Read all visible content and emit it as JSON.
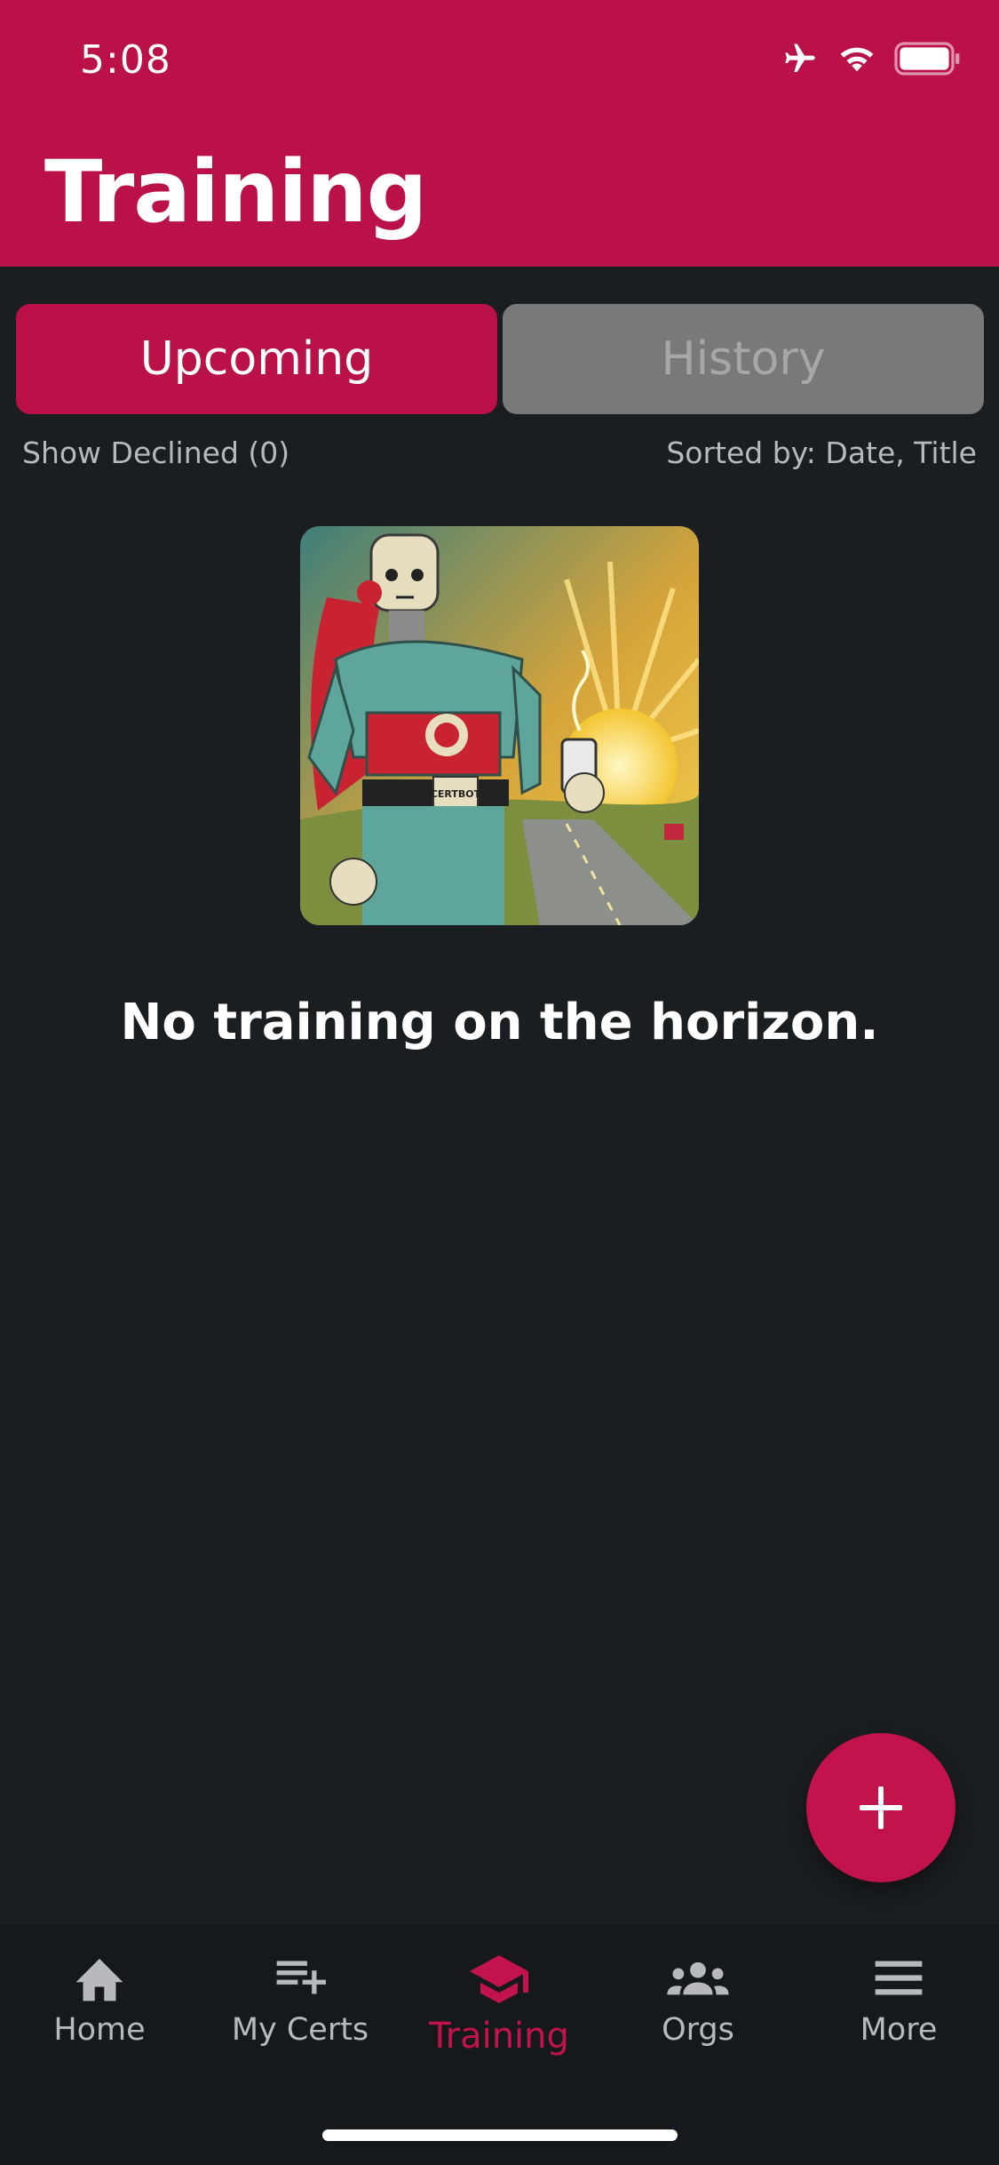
{
  "status_bar": {
    "time": "5:08"
  },
  "header": {
    "title": "Training"
  },
  "tabs": [
    {
      "label": "Upcoming",
      "active": true
    },
    {
      "label": "History",
      "active": false
    }
  ],
  "filters": {
    "show_declined": "Show Declined (0)",
    "sorted_by": "Sorted by: Date, Title"
  },
  "illustration": {
    "badge_text": "CERTBOT"
  },
  "empty_state": {
    "message": "No training on the horizon."
  },
  "nav": {
    "items": [
      {
        "label": "Home",
        "icon": "home-icon"
      },
      {
        "label": "My Certs",
        "icon": "playlist-add-icon"
      },
      {
        "label": "Training",
        "icon": "graduation-cap-icon",
        "active": true
      },
      {
        "label": "Orgs",
        "icon": "groups-icon"
      },
      {
        "label": "More",
        "icon": "menu-icon"
      }
    ]
  },
  "colors": {
    "accent": "#bb1149",
    "background": "#1b1e21",
    "nav_background": "#16191b",
    "inactive_tab": "#797979"
  }
}
